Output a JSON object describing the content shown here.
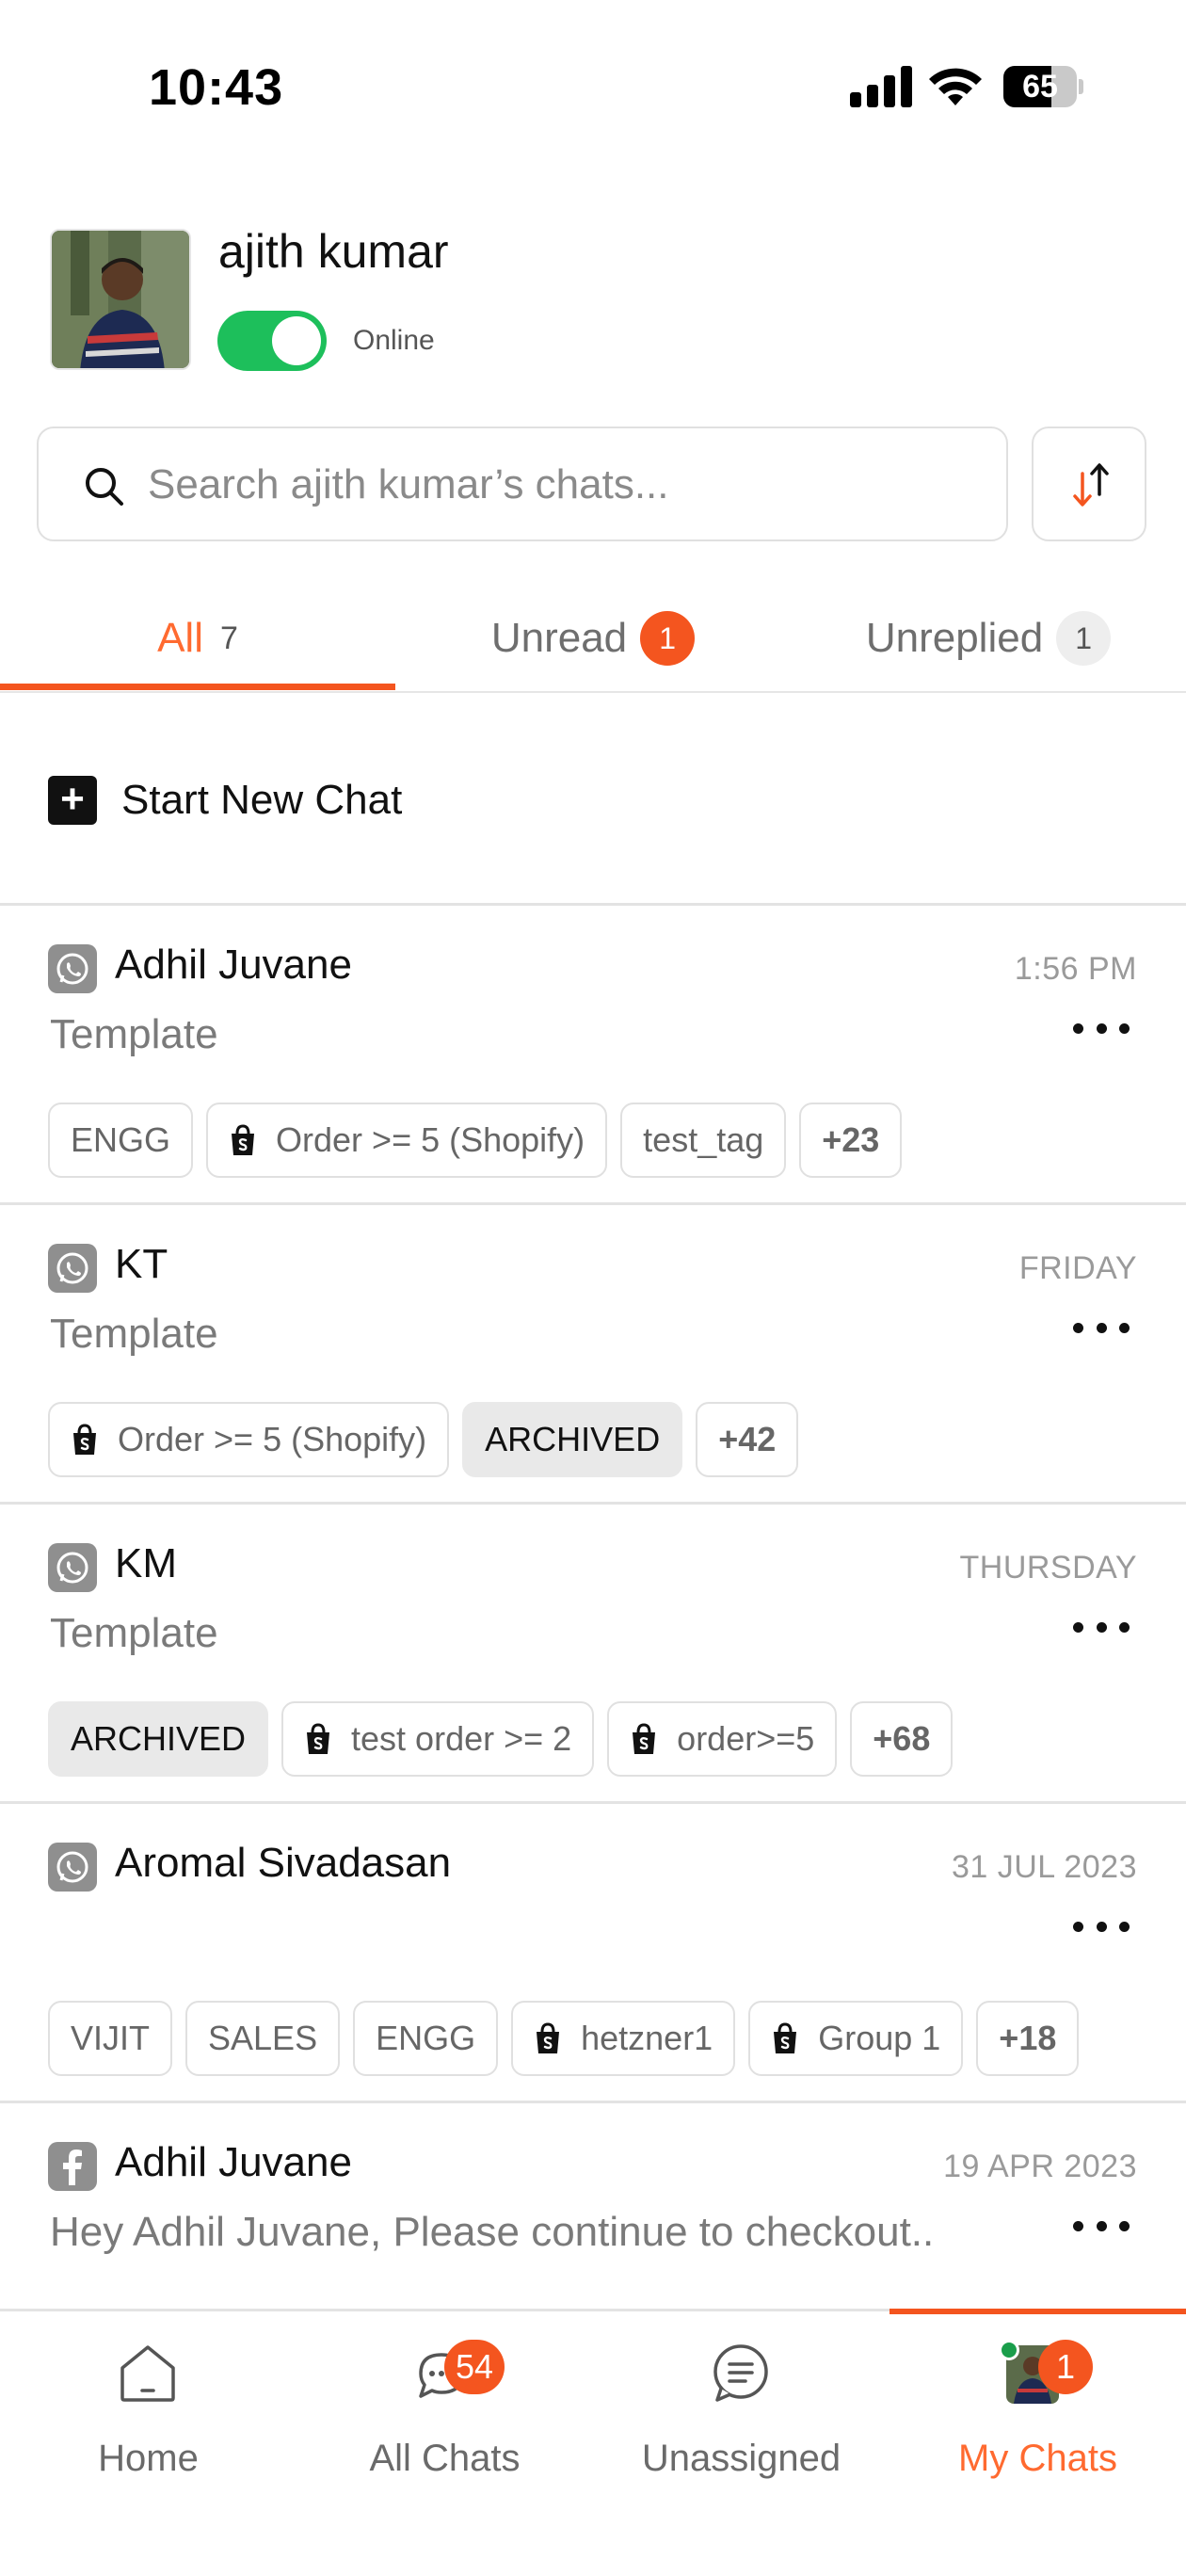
{
  "status_bar": {
    "time": "10:43",
    "battery": "65"
  },
  "profile": {
    "name": "ajith kumar",
    "status": "Online",
    "online_toggle": true
  },
  "search": {
    "placeholder": "Search ajith kumar’s chats...",
    "value": ""
  },
  "tabs": [
    {
      "label": "All",
      "count": "7",
      "active": true
    },
    {
      "label": "Unread",
      "count": "1"
    },
    {
      "label": "Unreplied",
      "count": "1"
    }
  ],
  "start_new_chat": "Start New Chat",
  "chats": [
    {
      "channel": "whatsapp-icon",
      "name": "Adhil Juvane",
      "time": "1:56 PM",
      "preview": "Template",
      "tags": [
        {
          "label": "ENGG",
          "type": "plain"
        },
        {
          "label": "Order >= 5 (Shopify)",
          "type": "shopify"
        },
        {
          "label": "test_tag",
          "type": "plain"
        },
        {
          "label": "+23",
          "type": "more"
        }
      ]
    },
    {
      "channel": "whatsapp-icon",
      "name": "KT",
      "time": "FRIDAY",
      "preview": "Template",
      "tags": [
        {
          "label": "Order >= 5 (Shopify)",
          "type": "shopify"
        },
        {
          "label": "ARCHIVED",
          "type": "archived"
        },
        {
          "label": "+42",
          "type": "more"
        }
      ]
    },
    {
      "channel": "whatsapp-icon",
      "name": "KM",
      "time": "THURSDAY",
      "preview": "Template",
      "tags": [
        {
          "label": "ARCHIVED",
          "type": "archived"
        },
        {
          "label": "test order >= 2",
          "type": "shopify"
        },
        {
          "label": "order>=5",
          "type": "shopify"
        },
        {
          "label": "+68",
          "type": "more"
        }
      ]
    },
    {
      "channel": "whatsapp-icon",
      "name": "Aromal Sivadasan",
      "time": "31 JUL 2023",
      "preview": "",
      "tags": [
        {
          "label": "VIJIT",
          "type": "plain"
        },
        {
          "label": "SALES",
          "type": "plain"
        },
        {
          "label": "ENGG",
          "type": "plain"
        },
        {
          "label": "hetzner1",
          "type": "shopify"
        },
        {
          "label": "Group 1",
          "type": "shopify"
        },
        {
          "label": "+18",
          "type": "more"
        }
      ]
    },
    {
      "channel": "facebook-icon",
      "name": "Adhil Juvane",
      "time": "19 APR 2023",
      "preview": "Hey Adhil Juvane, Please continue to checkout..",
      "tags": []
    }
  ],
  "bottom_nav": [
    {
      "label": "Home",
      "icon": "home-icon",
      "badge": ""
    },
    {
      "label": "All Chats",
      "icon": "chat-bubbles-icon",
      "badge": "54"
    },
    {
      "label": "Unassigned",
      "icon": "unassigned-chat-icon",
      "badge": ""
    },
    {
      "label": "My Chats",
      "icon": "avatar",
      "badge": "1",
      "active": true
    }
  ],
  "colors": {
    "accent": "#f4551f",
    "toggle_on": "#1dbf5b",
    "online_dot": "#1a9e4b"
  }
}
